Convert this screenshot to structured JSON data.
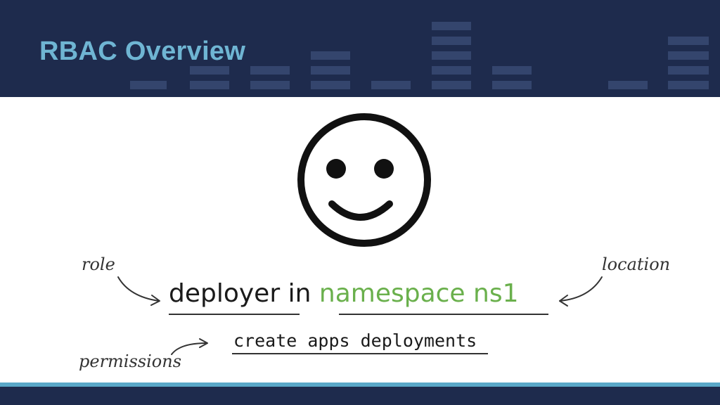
{
  "slide": {
    "title": "RBAC Overview",
    "role_word": "deployer",
    "connector_word": "in",
    "location_text": "namespace ns1",
    "permissions_text": "create apps deployments",
    "annotations": {
      "role": "role",
      "location": "location",
      "permissions": "permissions"
    }
  },
  "icons": {
    "user": "smiley-face-icon"
  },
  "colors": {
    "header_bg": "#1e2b4d",
    "title": "#6fb5d3",
    "accent_stripe": "#5aa8c8",
    "location_text": "#6ab04c"
  }
}
